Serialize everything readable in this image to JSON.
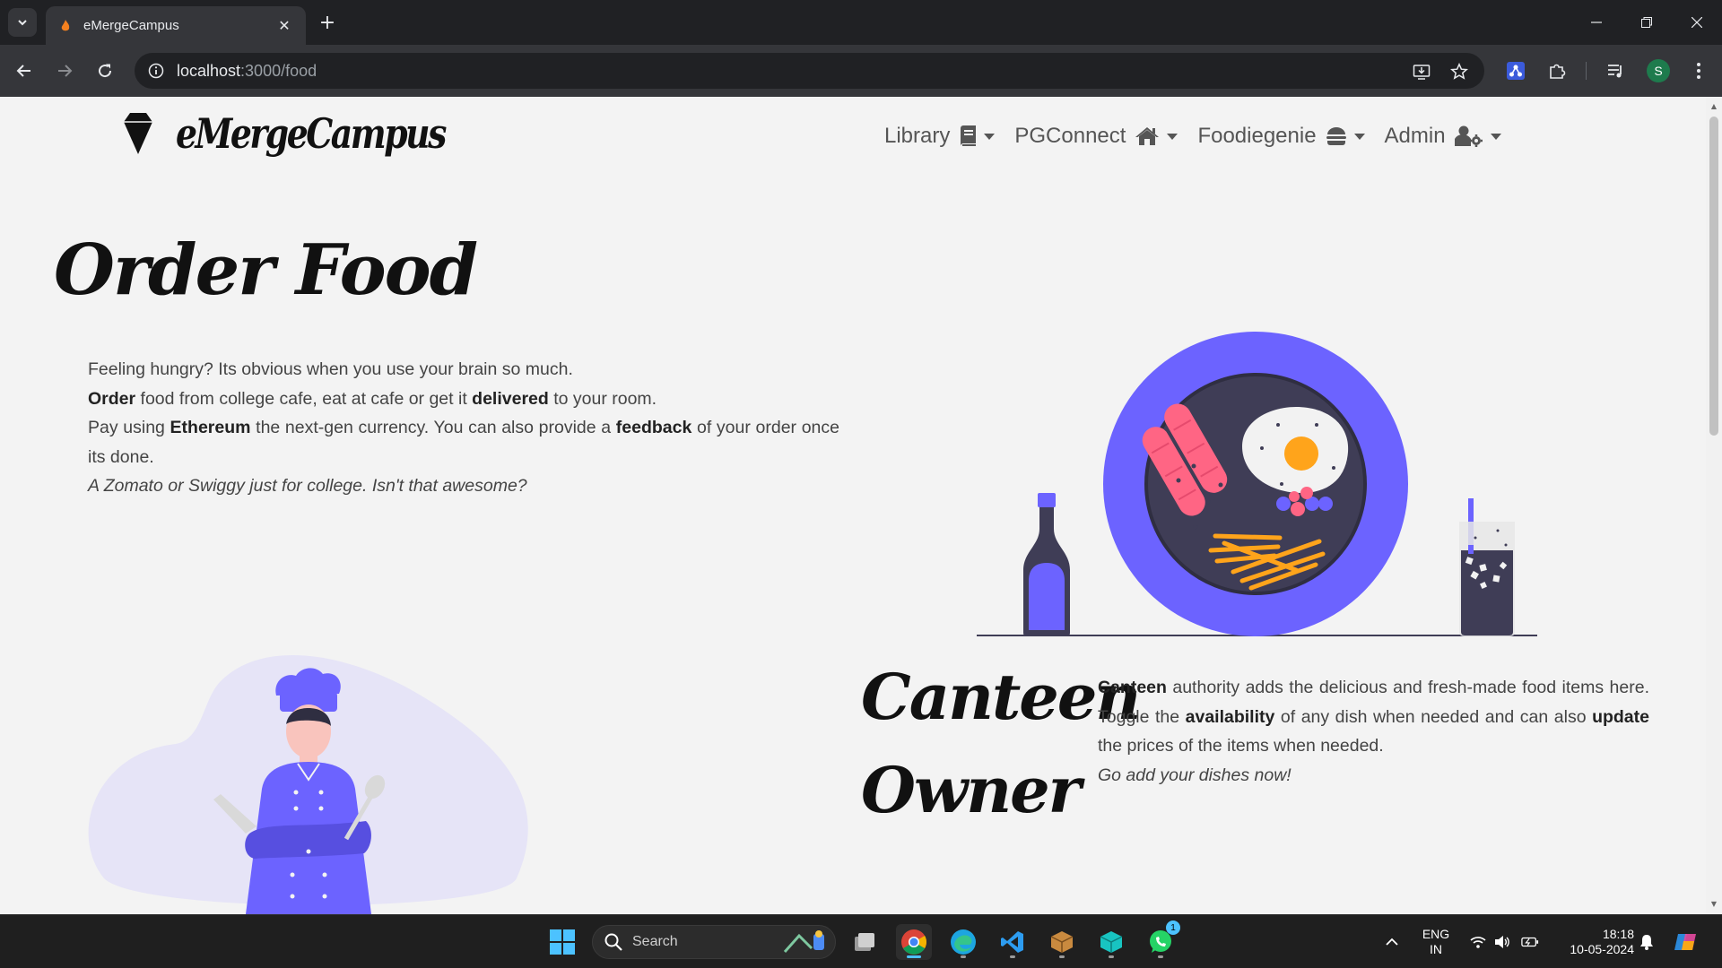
{
  "browser": {
    "tab_title": "eMergeCampus",
    "url_host": "localhost",
    "url_path": ":3000/food"
  },
  "site": {
    "brand": "eMergeCampus",
    "nav": [
      {
        "label": "Library",
        "icon": "book-icon"
      },
      {
        "label": "PGConnect",
        "icon": "home-icon"
      },
      {
        "label": "Foodiegenie",
        "icon": "burger-icon"
      },
      {
        "label": "Admin",
        "icon": "user-gear-icon"
      }
    ]
  },
  "hero": {
    "title": "Order Food",
    "line1": "Feeling hungry? Its obvious when you use your brain so much.",
    "line2_b1": "Order",
    "line2_t1": " food from college cafe, eat at cafe or get it ",
    "line2_b2": "delivered",
    "line2_t2": " to your room.",
    "line3_t1": "Pay using ",
    "line3_b1": "Ethereum",
    "line3_t2": " the next-gen currency. You can also provide a ",
    "line3_b2": "feedback",
    "line3_t3": " of your order once its done.",
    "line4": "A Zomato or Swiggy just for college. Isn't that awesome?"
  },
  "canteen": {
    "title": "Canteen Owner",
    "b1": "Canteen",
    "t1": " authority adds the delicious and fresh-made food items here. Toggle the ",
    "b2": "availability",
    "t2": " of any dish when needed and can also ",
    "b3": "update",
    "t3": " the prices of the items when needed.",
    "em": "Go add your dishes now!"
  },
  "taskbar": {
    "search_placeholder": "Search",
    "lang_line1": "ENG",
    "lang_line2": "IN",
    "time": "18:18",
    "date": "10-05-2024",
    "whatsapp_badge": "1"
  },
  "colors": {
    "accent": "#6c63ff",
    "plate_inner": "#3f3d56",
    "sausage": "#ff6584",
    "yolk": "#ffa41b"
  }
}
